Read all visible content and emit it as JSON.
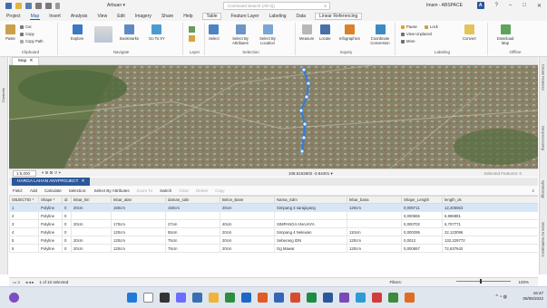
{
  "titlebar": {
    "app_title": "Arbuan ▾",
    "search_placeholder": "Command Search (Alt+Q)",
    "user": "Imam - ABSPACE",
    "badge": "A",
    "min": "–",
    "max": "□",
    "close": "✕",
    "help": "?"
  },
  "tabs": [
    "Project",
    "Map",
    "Insert",
    "Analysis",
    "View",
    "Edit",
    "Imagery",
    "Share",
    "Help",
    "Table",
    "Feature Layer",
    "Labeling",
    "Data",
    "Linear Referencing"
  ],
  "ribbon": {
    "clipboard": {
      "paste": "Paste",
      "cut": "Cut",
      "copy": "Copy",
      "copy_path": "Copy Path",
      "label": "Clipboard"
    },
    "navigate": {
      "explore": "Explore",
      "bookmarks": "Bookmarks",
      "goto": "Go To XY",
      "label": "Navigate"
    },
    "layer": {
      "basemap": "Basemap",
      "add_data": "Add Data",
      "label": "Layer"
    },
    "selection": {
      "select": "Select",
      "by_attr": "Select By Attributes",
      "by_loc": "Select By Location",
      "label": "Selection"
    },
    "inquiry": {
      "measure": "Measure",
      "locate": "Locate",
      "infographics": "Infographics",
      "coord_conv": "Coordinate Conversion",
      "label": "Inquiry"
    },
    "labeling": {
      "pause": "Pause",
      "lock": "Lock",
      "view_unplaced": "View Unplaced",
      "more": "More",
      "label": "Labeling"
    },
    "convert": {
      "label_btn": "Convert"
    },
    "offline": {
      "download": "Download Map",
      "label": "Offline"
    }
  },
  "left_panel_label": "Contents",
  "right_panel_labels": [
    "Create Features",
    "Geoprocessing",
    "Symbology",
    "Show As Notifications"
  ],
  "map": {
    "tab": "Map",
    "scale": "1:5,000",
    "coordinates": "108.5162602 -3.94401 ▾",
    "selected_features": "Selected Features: 0"
  },
  "table": {
    "tab": "HARGA LAHAN ANYPROJECT",
    "tools": {
      "field": "Field:",
      "add": "Add",
      "calculate": "Calculate",
      "selection": "Selection:",
      "by_attr": "Select By Attributes",
      "zoom": "Zoom To",
      "switch": "Switch",
      "clear": "Clear",
      "delete": "Delete",
      "copy": "Copy"
    },
    "columns": [
      "OBJECTID *",
      "Shape *",
      "id",
      "lebar_kiri",
      "lebar_alan",
      "daman_sals",
      "Belon_Bane",
      "Nama_Sdrn",
      "lebar_bana",
      "Shape_Length",
      "length_ok"
    ],
    "rows": [
      [
        "1",
        "Polyline",
        "0",
        "20cm",
        "150cm",
        "150cm",
        "20cm",
        "Simpang 3 sarajayang",
        "120cm",
        "0,009711",
        "12,205553"
      ],
      [
        "2",
        "Polyline",
        "0",
        "",
        "",
        "",
        "",
        "",
        "",
        "0,000655",
        "6,986881"
      ],
      [
        "3",
        "Polyline",
        "0",
        "20cm",
        "170cm",
        "27cm",
        "40cm",
        "SIMPANG4 ANAJAYA",
        "",
        "0,000702",
        "6,707771"
      ],
      [
        "4",
        "Polyline",
        "0",
        "",
        "120cm",
        "55cm",
        "20cm",
        "Simpang 4 Nelewan",
        "110cm",
        "0,000295",
        "22,123096"
      ],
      [
        "5",
        "Polyline",
        "0",
        "20cm",
        "120cm",
        "75cm",
        "20cm",
        "Seberang IDN",
        "120cm",
        "0,0012",
        "132,229772"
      ],
      [
        "6",
        "Polyline",
        "0",
        "20cm",
        "120cm",
        "75cm",
        "20cm",
        "Gg Mawar",
        "120cm",
        "0,000657",
        "72,637642"
      ]
    ],
    "status": "1 of 10 selected",
    "filters": "Filters:",
    "zoom": "100%"
  },
  "taskbar": {
    "time": "16:47",
    "date": "09/05/2022"
  }
}
